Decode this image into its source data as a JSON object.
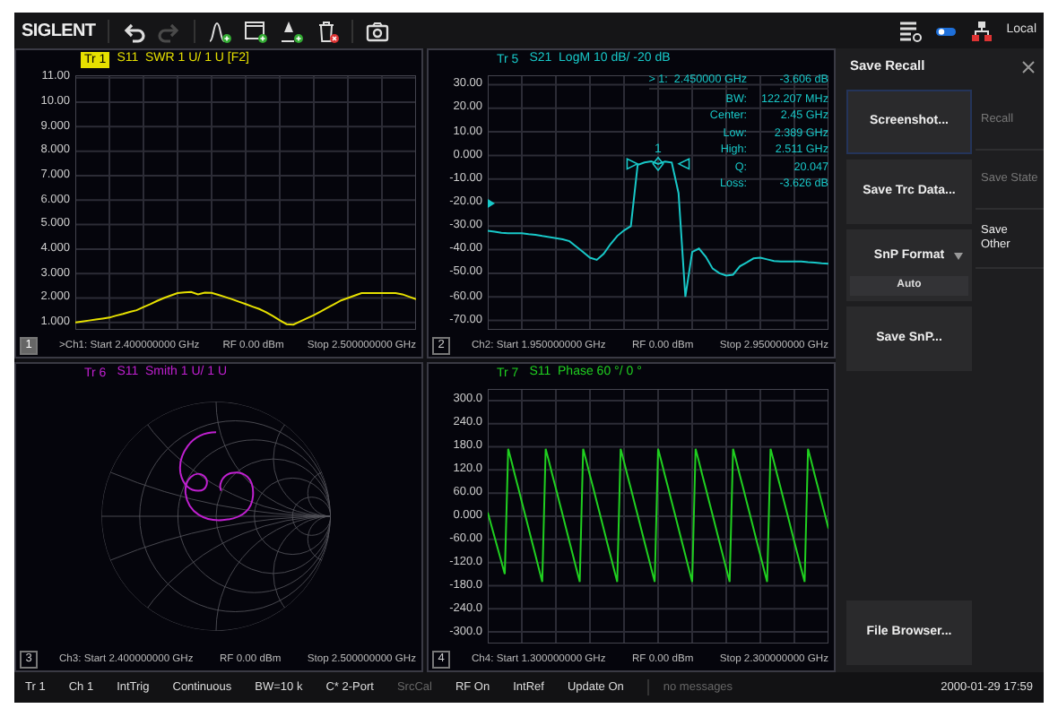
{
  "toolbar": {
    "logo": "SIGLENT",
    "left_groups": [
      [
        {
          "kind": "undo",
          "disabled": false
        },
        {
          "kind": "redo",
          "disabled": true
        }
      ],
      [
        {
          "kind": "add-trace",
          "disabled": false
        },
        {
          "kind": "add-window",
          "disabled": false
        },
        {
          "kind": "add-marker",
          "disabled": false
        },
        {
          "kind": "delete",
          "disabled": false
        }
      ],
      [
        {
          "kind": "camera",
          "disabled": false
        }
      ]
    ],
    "right_icons": [
      {
        "kind": "list",
        "disabled": false
      },
      {
        "kind": "toggle",
        "disabled": false
      },
      {
        "kind": "network",
        "disabled": false
      }
    ],
    "mode": "Local"
  },
  "panels": [
    {
      "number": "1",
      "kind": "swr",
      "active": true,
      "color": "#e6e000",
      "trace_tag": "Tr 1",
      "trace_title": "S11  SWR 1 U/ 1 U [F2]",
      "chart_data": {
        "type": "line",
        "grid": true,
        "ylim": [
          0.7,
          11.1
        ],
        "yticks": [
          {
            "value": 11,
            "label": "11.00"
          },
          {
            "value": 10,
            "label": "10.00"
          },
          {
            "value": 9,
            "label": "9.000"
          },
          {
            "value": 8,
            "label": "8.000"
          },
          {
            "value": 7,
            "label": "7.000"
          },
          {
            "value": 6,
            "label": "6.000"
          },
          {
            "value": 5,
            "label": "5.000"
          },
          {
            "value": 4,
            "label": "4.000"
          },
          {
            "value": 3,
            "label": "3.000"
          },
          {
            "value": 2,
            "label": "2.000"
          },
          {
            "value": 1,
            "label": "1.000"
          }
        ],
        "categories": [
          null,
          null,
          null,
          null,
          null,
          null,
          null,
          null,
          null,
          null,
          null,
          null,
          null,
          null,
          null,
          null,
          null,
          null,
          null,
          null,
          null,
          null,
          null,
          null,
          null,
          null,
          null,
          null,
          null,
          null,
          null,
          null,
          null,
          null,
          null,
          null,
          null,
          null,
          null,
          null,
          null,
          null,
          null,
          null,
          null,
          null,
          null,
          null,
          null,
          null,
          null
        ],
        "series": [
          {
            "color": "#e6e000",
            "values": [
              1.0,
              1.04,
              1.08,
              1.12,
              1.16,
              1.2,
              1.28,
              1.35,
              1.43,
              1.5,
              1.63,
              1.75,
              1.88,
              2.0,
              2.1,
              2.2,
              2.23,
              2.25,
              2.15,
              2.22,
              2.21,
              2.13,
              2.04,
              1.95,
              1.85,
              1.75,
              1.65,
              1.55,
              1.42,
              1.26,
              1.09,
              0.93,
              0.91,
              1.04,
              1.17,
              1.3,
              1.45,
              1.6,
              1.75,
              1.9,
              2.0,
              2.1,
              2.2,
              2.2,
              2.2,
              2.2,
              2.2,
              2.2,
              2.15,
              2.05,
              1.95
            ]
          }
        ]
      },
      "footer": [
        ">Ch1: Start 2.400000000 GHz",
        "RF 0.00 dBm",
        "Stop 2.500000000 GHz"
      ]
    },
    {
      "number": "2",
      "kind": "logm",
      "active": false,
      "color": "#18c8c8",
      "trace_tag": "Tr 5",
      "trace_title": "S21  LogM 10 dB/ -20 dB",
      "chart_data": {
        "type": "line",
        "grid": true,
        "ylim": [
          -74,
          34
        ],
        "yticks": [
          {
            "value": 30,
            "label": "30.00"
          },
          {
            "value": 20,
            "label": "20.00"
          },
          {
            "value": 10,
            "label": "10.00"
          },
          {
            "value": 0,
            "label": "0.000"
          },
          {
            "value": -10,
            "label": "-10.00"
          },
          {
            "value": -20,
            "label": "-20.00"
          },
          {
            "value": -30,
            "label": "-30.00"
          },
          {
            "value": -40,
            "label": "-40.00"
          },
          {
            "value": -50,
            "label": "-50.00"
          },
          {
            "value": -60,
            "label": "-60.00"
          },
          {
            "value": -70,
            "label": "-70.00"
          }
        ],
        "categories": [
          null,
          null,
          null,
          null,
          null,
          null,
          null,
          null,
          null,
          null,
          null,
          null,
          null,
          null,
          null,
          null,
          null,
          null,
          null,
          null,
          null,
          null,
          null,
          null,
          null,
          null,
          null,
          null,
          null,
          null,
          null,
          null,
          null,
          null,
          null,
          null,
          null,
          null,
          null,
          null,
          null,
          null,
          null,
          null,
          null,
          null,
          null,
          null,
          null,
          null,
          null
        ],
        "series": [
          {
            "color": "#18c8c8",
            "values": [
              -32,
              -32.4,
              -32.8,
              -33,
              -33,
              -33,
              -33.4,
              -33.7,
              -34.2,
              -34.6,
              -35.1,
              -35.6,
              -36.4,
              -38.7,
              -41,
              -43.4,
              -44.3,
              -41.8,
              -37.7,
              -34.2,
              -31.8,
              -30,
              -4,
              -3,
              -2.5,
              -3.6,
              -2.6,
              -3,
              -16,
              -60,
              -41,
              -39.5,
              -43,
              -48,
              -50,
              -51,
              -50.6,
              -47,
              -45.4,
              -43.7,
              -43.4,
              -44.1,
              -44.8,
              -45,
              -45,
              -45,
              -45,
              -45.3,
              -45.5,
              -45.8,
              -46
            ]
          }
        ]
      },
      "marker_label": "1",
      "marker_readout": {
        "header": [
          "> 1:  2.450000 GHz",
          "-3.606 dB"
        ],
        "rows": [
          {
            "name": "BW:",
            "value": "122.207 MHz"
          },
          {
            "name": "Center:",
            "value": "2.45 GHz"
          },
          {
            "name": "Low:",
            "value": "2.389 GHz"
          },
          {
            "name": "High:",
            "value": "2.511 GHz"
          },
          {
            "name": "Q:",
            "value": "20.047"
          },
          {
            "name": "Loss:",
            "value": "-3.626 dB"
          }
        ]
      },
      "footer": [
        "Ch2: Start 1.950000000 GHz",
        "RF 0.00 dBm",
        "Stop 2.950000000 GHz"
      ]
    },
    {
      "number": "3",
      "kind": "smith",
      "active": false,
      "color": "#c020d0",
      "trace_tag": "Tr 6",
      "trace_title": "S11  Smith 1 U/ 1 U",
      "footer": [
        "Ch3: Start 2.400000000 GHz",
        "RF 0.00 dBm",
        "Stop 2.500000000 GHz"
      ]
    },
    {
      "number": "4",
      "kind": "phase",
      "active": false,
      "color": "#20d020",
      "trace_tag": "Tr 7",
      "trace_title": "S11  Phase 60 °/ 0 °",
      "chart_data": {
        "type": "line",
        "grid": true,
        "ylim": [
          -330,
          330
        ],
        "yticks": [
          {
            "value": 300,
            "label": "300.0"
          },
          {
            "value": 240,
            "label": "240.0"
          },
          {
            "value": 180,
            "label": "180.0"
          },
          {
            "value": 120,
            "label": "120.0"
          },
          {
            "value": 60,
            "label": "60.00"
          },
          {
            "value": 0,
            "label": "0.000"
          },
          {
            "value": -60,
            "label": "-60.00"
          },
          {
            "value": -120,
            "label": "-120.0"
          },
          {
            "value": -180,
            "label": "-180.0"
          },
          {
            "value": -240,
            "label": "-240.0"
          },
          {
            "value": -300,
            "label": "-300.0"
          }
        ],
        "categories": [
          null,
          null,
          null,
          null,
          null,
          null,
          null,
          null,
          null,
          null,
          null,
          null,
          null,
          null,
          null,
          null,
          null,
          null,
          null,
          null,
          null,
          null,
          null,
          null,
          null,
          null,
          null,
          null,
          null,
          null,
          null,
          null,
          null,
          null,
          null,
          null,
          null,
          null,
          null,
          null,
          null,
          null,
          null,
          null,
          null,
          null,
          null,
          null,
          null,
          null,
          null,
          null,
          null,
          null,
          null,
          null,
          null,
          null,
          null,
          null,
          null,
          null,
          null,
          null,
          null,
          null,
          null,
          null,
          null,
          null,
          null,
          null,
          null,
          null,
          null,
          null,
          null,
          null,
          null,
          null,
          null,
          null,
          null,
          null,
          null,
          null,
          null,
          null,
          null,
          null,
          null,
          null,
          null,
          null,
          null,
          null,
          null,
          null,
          null,
          null,
          null
        ],
        "series": [
          {
            "color": "#20d020",
            "values": [
              10,
              -22,
              -54,
              -86,
              -118,
              -150,
              175,
              141,
              106,
              72,
              37,
              3,
              -32,
              -67,
              -101,
              -136,
              -170,
              175,
              141,
              106,
              72,
              37,
              3,
              -32,
              -67,
              -101,
              -136,
              -170,
              175,
              141,
              106,
              72,
              37,
              3,
              -32,
              -67,
              -101,
              -136,
              -170,
              175,
              141,
              106,
              72,
              37,
              3,
              -32,
              -67,
              -101,
              -136,
              -170,
              175,
              141,
              106,
              72,
              37,
              3,
              -32,
              -67,
              -101,
              -136,
              -170,
              175,
              141,
              106,
              72,
              37,
              3,
              -32,
              -67,
              -101,
              -136,
              -170,
              175,
              141,
              106,
              72,
              37,
              3,
              -32,
              -67,
              -101,
              -136,
              -170,
              175,
              141,
              106,
              72,
              37,
              3,
              -32,
              -67,
              -101,
              -136,
              -170,
              175,
              141,
              106,
              72,
              37,
              3,
              -32
            ]
          }
        ]
      },
      "footer": [
        "Ch4: Start 1.300000000 GHz",
        "RF 0.00 dBm",
        "Stop 2.300000000 GHz"
      ]
    }
  ],
  "side_panel": {
    "title": "Save Recall",
    "buttons": [
      {
        "kind": "button",
        "label": "Screenshot...",
        "selected": true
      },
      {
        "kind": "button",
        "label": "Save Trc Data...",
        "selected": false
      },
      {
        "kind": "dropdown",
        "label": "SnP Format",
        "value": "Auto",
        "selected": false
      },
      {
        "kind": "button",
        "label": "Save SnP...",
        "selected": false
      }
    ],
    "bottom_button": {
      "label": "File Browser..."
    },
    "tabs": [
      {
        "label": "Recall",
        "selected": false
      },
      {
        "label": "Save State",
        "selected": false
      },
      {
        "label": "Save Other",
        "selected": true
      }
    ]
  },
  "status_bar": {
    "items": [
      {
        "text": "Tr 1",
        "disabled": false
      },
      {
        "text": "Ch 1",
        "disabled": false
      },
      {
        "text": "IntTrig",
        "disabled": false
      },
      {
        "text": "Continuous",
        "disabled": false
      },
      {
        "text": "BW=10 k",
        "disabled": false
      },
      {
        "text": "C* 2-Port",
        "disabled": false
      },
      {
        "text": "SrcCal",
        "disabled": true
      },
      {
        "text": "RF On",
        "disabled": false
      },
      {
        "text": "IntRef",
        "disabled": false
      },
      {
        "text": "Update On",
        "disabled": false
      }
    ],
    "message": "no messages",
    "datetime": "2000-01-29 17:59"
  }
}
